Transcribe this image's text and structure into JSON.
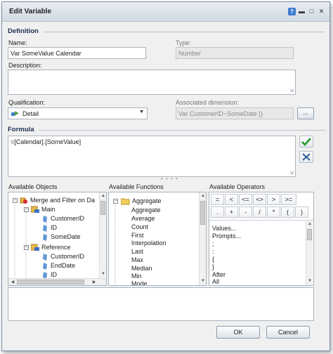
{
  "window": {
    "title": "Edit Variable"
  },
  "sections": {
    "definition": "Definition",
    "formula": "Formula"
  },
  "name": {
    "label": "Name:",
    "value": "Var SomeValue Calendar"
  },
  "type": {
    "label": "Type:",
    "value": "Number"
  },
  "description": {
    "label": "Description:",
    "value": ""
  },
  "qualification": {
    "label": "Qualification:",
    "value": "Detail"
  },
  "associated_dimension": {
    "label": "Associated dimension:",
    "value": "Var CustomerID~SomeDate ()",
    "button_label": "..."
  },
  "formula": {
    "value": "=[Calendar].[SomeValue]"
  },
  "available_objects": {
    "label": "Available Objects",
    "items": [
      "Merge and Filter on Da",
      "Main",
      "CustomerID",
      "ID",
      "SomeDate",
      "Reference",
      "CustomerID",
      "EndDate",
      "ID"
    ]
  },
  "available_functions": {
    "label": "Available Functions",
    "group": "Aggregate",
    "items": [
      "Aggregate",
      "Average",
      "Count",
      "First",
      "Interpolation",
      "Last",
      "Max",
      "Median",
      "Min",
      "Mode"
    ]
  },
  "available_operators": {
    "label": "Available Operators",
    "row1": [
      "=",
      "<",
      "<=",
      "<>",
      ">",
      ">="
    ],
    "row2": [
      ".",
      "+",
      "-",
      "/",
      "*",
      "("
    ],
    "row2_extra": ")",
    "items": [
      "Values...",
      "Prompts...",
      ";",
      ":",
      "{",
      "}",
      "After",
      "All"
    ]
  },
  "buttons": {
    "ok": "OK",
    "cancel": "Cancel"
  },
  "colors": {
    "section_title": "#1a2f4f",
    "validate_check": "#1f9a2a",
    "cancel_x": "#2d5c9c"
  }
}
